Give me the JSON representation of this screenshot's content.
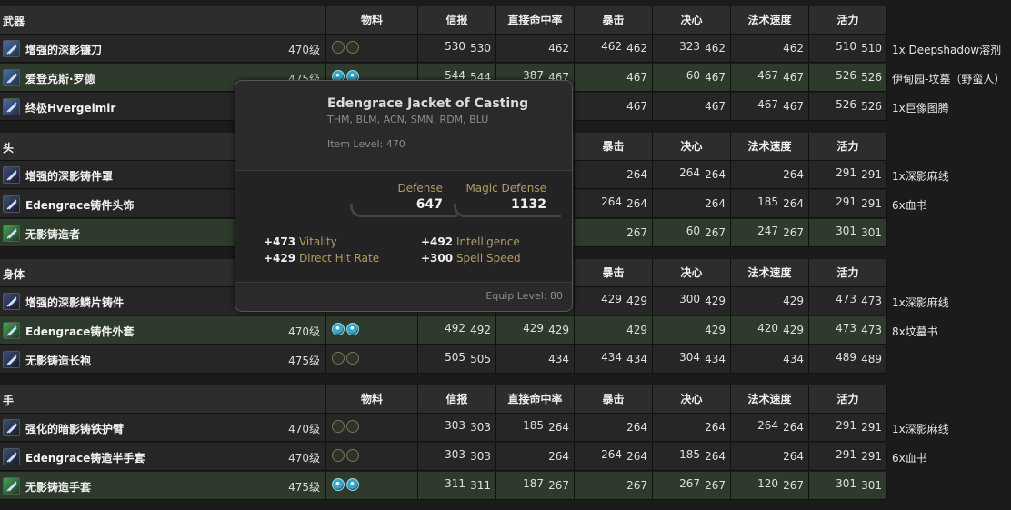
{
  "columns": {
    "materia": "物料",
    "crit_info": "信报",
    "direct_hit": "直接命中率",
    "crit": "暴击",
    "determination": "决心",
    "spell_speed": "法术速度",
    "vitality": "活力"
  },
  "sections": [
    {
      "label": "武器",
      "rows": [
        {
          "name": "增强的深影镰刀",
          "ilvl": "470级",
          "materia": "empty",
          "a": [
            "530",
            "530"
          ],
          "b": [
            "",
            "462"
          ],
          "c": [
            "462",
            "462"
          ],
          "d": [
            "323",
            "462"
          ],
          "e": [
            "",
            "462"
          ],
          "f": [
            "510",
            "510"
          ],
          "note": "1x Deepshadow溶剂",
          "green": false
        },
        {
          "name": "爱登克斯·罗德",
          "ilvl": "475级",
          "materia": "full",
          "a": [
            "544",
            "544"
          ],
          "b": [
            "387",
            "467"
          ],
          "c": [
            "",
            "467"
          ],
          "d": [
            "60",
            "467"
          ],
          "e": [
            "467",
            "467"
          ],
          "f": [
            "526",
            "526"
          ],
          "note": "伊甸园-坟墓（野蛮人）",
          "green": true
        },
        {
          "name": "终极Hvergelmir",
          "ilvl": "",
          "materia": "",
          "a": [
            "",
            ""
          ],
          "b": [
            "",
            ""
          ],
          "c": [
            "",
            "467"
          ],
          "d": [
            "",
            "467"
          ],
          "e": [
            "467",
            "467"
          ],
          "f": [
            "526",
            "526"
          ],
          "note": "1x巨像图腾",
          "green": false
        }
      ]
    },
    {
      "label": "头",
      "rows": [
        {
          "name": "增强的深影铸件罩",
          "ilvl": "",
          "materia": "",
          "a": [
            "",
            ""
          ],
          "b": [
            "",
            ""
          ],
          "c": [
            "",
            "264"
          ],
          "d": [
            "264",
            "264"
          ],
          "e": [
            "",
            "264"
          ],
          "f": [
            "291",
            "291"
          ],
          "note": "1x深影麻线",
          "green": false
        },
        {
          "name": "Edengrace铸件头饰",
          "ilvl": "",
          "materia": "",
          "a": [
            "",
            ""
          ],
          "b": [
            "",
            ""
          ],
          "c": [
            "264",
            "264"
          ],
          "d": [
            "",
            "264"
          ],
          "e": [
            "185",
            "264"
          ],
          "f": [
            "291",
            "291"
          ],
          "note": "6x血书",
          "green": false
        },
        {
          "name": "无影铸造者",
          "ilvl": "",
          "materia": "",
          "a": [
            "",
            ""
          ],
          "b": [
            "",
            ""
          ],
          "c": [
            "",
            "267"
          ],
          "d": [
            "60",
            "267"
          ],
          "e": [
            "247",
            "267"
          ],
          "f": [
            "301",
            "301"
          ],
          "note": "",
          "green": true
        }
      ]
    },
    {
      "label": "身体",
      "rows": [
        {
          "name": "增强的深影鳞片铸件",
          "ilvl": "",
          "materia": "",
          "a": [
            "",
            ""
          ],
          "b": [
            "",
            ""
          ],
          "c": [
            "429",
            "429"
          ],
          "d": [
            "300",
            "429"
          ],
          "e": [
            "",
            "429"
          ],
          "f": [
            "473",
            "473"
          ],
          "note": "1x深影麻线",
          "green": false
        },
        {
          "name": "Edengrace铸件外套",
          "ilvl": "470级",
          "materia": "full",
          "a": [
            "492",
            "492"
          ],
          "b": [
            "429",
            "429"
          ],
          "c": [
            "",
            "429"
          ],
          "d": [
            "",
            "429"
          ],
          "e": [
            "420",
            "429"
          ],
          "f": [
            "473",
            "473"
          ],
          "note": "8x坟墓书",
          "green": true
        },
        {
          "name": "无影铸造长袍",
          "ilvl": "475级",
          "materia": "empty",
          "a": [
            "505",
            "505"
          ],
          "b": [
            "",
            "434"
          ],
          "c": [
            "434",
            "434"
          ],
          "d": [
            "304",
            "434"
          ],
          "e": [
            "",
            "434"
          ],
          "f": [
            "489",
            "489"
          ],
          "note": "",
          "green": false
        }
      ]
    },
    {
      "label": "手",
      "rows": [
        {
          "name": "强化的暗影铸铁护臂",
          "ilvl": "470级",
          "materia": "empty",
          "a": [
            "303",
            "303"
          ],
          "b": [
            "185",
            "264"
          ],
          "c": [
            "",
            "264"
          ],
          "d": [
            "",
            "264"
          ],
          "e": [
            "264",
            "264"
          ],
          "f": [
            "291",
            "291"
          ],
          "note": "1x深影麻线",
          "green": false
        },
        {
          "name": "Edengrace铸造半手套",
          "ilvl": "470级",
          "materia": "empty",
          "a": [
            "303",
            "303"
          ],
          "b": [
            "",
            "264"
          ],
          "c": [
            "264",
            "264"
          ],
          "d": [
            "185",
            "264"
          ],
          "e": [
            "",
            "264"
          ],
          "f": [
            "291",
            "291"
          ],
          "note": "6x血书",
          "green": false
        },
        {
          "name": "无影铸造手套",
          "ilvl": "475级",
          "materia": "full",
          "a": [
            "311",
            "311"
          ],
          "b": [
            "187",
            "267"
          ],
          "c": [
            "",
            "267"
          ],
          "d": [
            "267",
            "267"
          ],
          "e": [
            "120",
            "267"
          ],
          "f": [
            "301",
            "301"
          ],
          "note": "",
          "green": true
        }
      ]
    }
  ],
  "tooltip": {
    "title": "Edengrace Jacket of Casting",
    "jobs": "THM, BLM, ACN, SMN, RDM, BLU",
    "item_level": "Item Level: 470",
    "defense_label": "Defense",
    "defense_value": "647",
    "mdef_label": "Magic Defense",
    "mdef_value": "1132",
    "bonuses": [
      {
        "value": "+473",
        "label": "Vitality"
      },
      {
        "value": "+492",
        "label": "Intelligence"
      },
      {
        "value": "+429",
        "label": "Direct Hit Rate"
      },
      {
        "value": "+300",
        "label": "Spell Speed"
      }
    ],
    "equip_level": "Equip Level: 80"
  }
}
